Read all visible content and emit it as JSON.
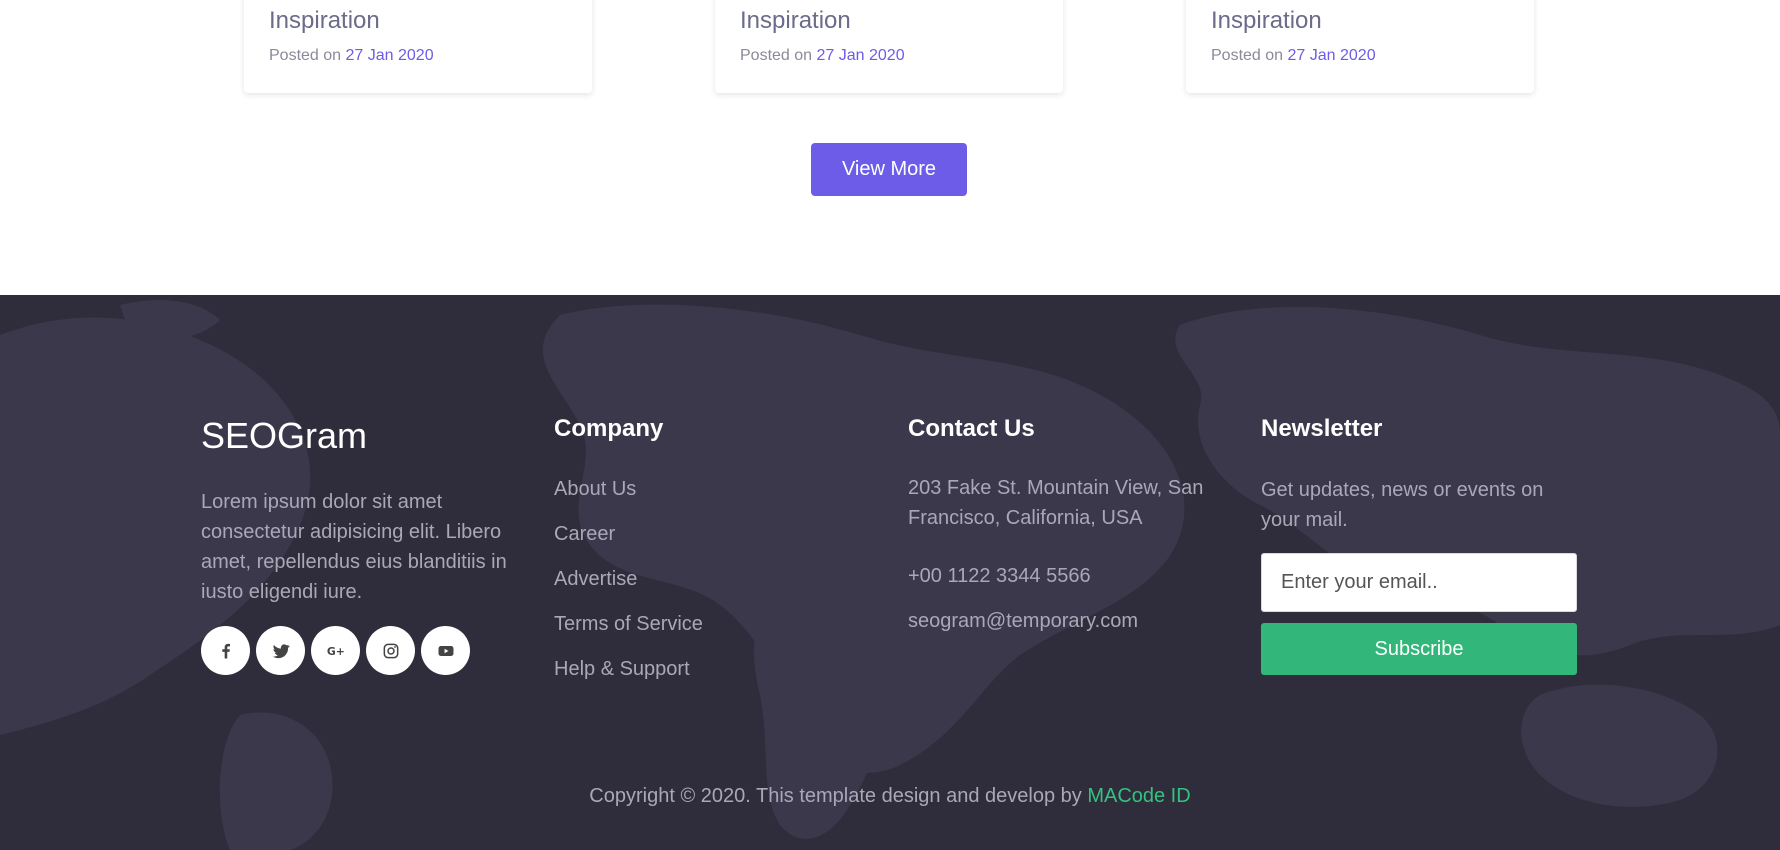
{
  "blog": {
    "cards": [
      {
        "title": "Inspiration",
        "posted_prefix": "Posted on",
        "date": "27 Jan 2020"
      },
      {
        "title": "Inspiration",
        "posted_prefix": "Posted on",
        "date": "27 Jan 2020"
      },
      {
        "title": "Inspiration",
        "posted_prefix": "Posted on",
        "date": "27 Jan 2020"
      }
    ],
    "view_more_label": "View More"
  },
  "footer": {
    "brand": "SEOGram",
    "about": "Lorem ipsum dolor sit amet consectetur adipisicing elit. Libero amet, repellendus eius blanditiis in iusto eligendi iure.",
    "socials": [
      "facebook-icon",
      "twitter-icon",
      "google-plus-icon",
      "instagram-icon",
      "youtube-icon"
    ],
    "google_plus_glyph": "G+",
    "company": {
      "heading": "Company",
      "links": [
        "About Us",
        "Career",
        "Advertise",
        "Terms of Service",
        "Help & Support"
      ]
    },
    "contact": {
      "heading": "Contact Us",
      "address_line1": "203 Fake St. Mountain View, San",
      "address_line2": "Francisco, California, USA",
      "phone": "+00 1122 3344 5566",
      "email": "seogram@temporary.com"
    },
    "newsletter": {
      "heading": "Newsletter",
      "text": "Get updates, news or events on your mail.",
      "placeholder": "Enter your email..",
      "subscribe_label": "Subscribe"
    },
    "copyright_text": "Copyright © 2020. This template design and develop by",
    "copyright_link": "MACode ID"
  },
  "colors": {
    "accent": "#6c5ce7",
    "footer_bg": "#2f2d3c",
    "subscribe": "#33b679",
    "link_green": "#33c27f"
  }
}
